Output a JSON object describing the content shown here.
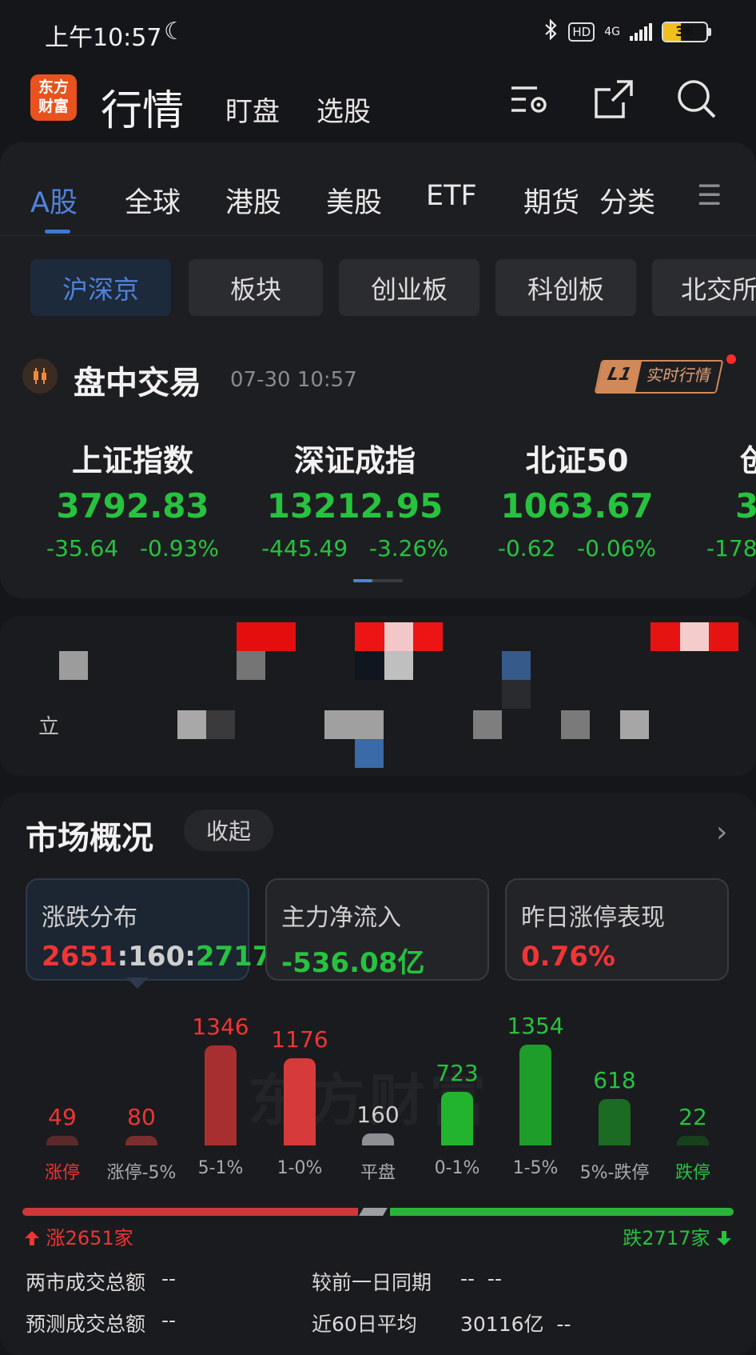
{
  "status_bar": {
    "time": "上午10:57",
    "hd": "HD",
    "network": "4G",
    "battery": "36"
  },
  "header": {
    "logo_text": "东方\n财富",
    "title": "行情",
    "tabs": [
      "盯盘",
      "选股"
    ]
  },
  "market_tabs": [
    "A股",
    "全球",
    "港股",
    "美股",
    "ETF",
    "期货",
    "分类"
  ],
  "chips": [
    "沪深京",
    "板块",
    "创业板",
    "科创板",
    "北交所"
  ],
  "session": {
    "title": "盘中交易",
    "time": "07-30 10:57",
    "badge_a": "L1",
    "badge_b": "实时行情"
  },
  "indices": [
    {
      "name": "上证指数",
      "value": "3792.83",
      "change": "-35.64",
      "pct": "-0.93%"
    },
    {
      "name": "深证成指",
      "value": "13212.95",
      "change": "-445.49",
      "pct": "-3.26%"
    },
    {
      "name": "北证50",
      "value": "1063.67",
      "change": "-0.62",
      "pct": "-0.06%"
    },
    {
      "name": "创",
      "value": "3",
      "change": "-178",
      "pct": ""
    }
  ],
  "mosaic": {
    "char": "立"
  },
  "overview": {
    "title": "市场概况",
    "collapse_label": "收起",
    "stats": [
      {
        "label": "涨跌分布",
        "up": "2651",
        "flat": "160",
        "down": "2717"
      },
      {
        "label": "主力净流入",
        "value": "-536.08亿"
      },
      {
        "label": "昨日涨停表现",
        "value": "0.76%"
      }
    ],
    "watermark": "东方财富",
    "distribution": [
      {
        "label": "涨停",
        "count": 49,
        "color": "#5a2a2a",
        "text_color": "#ef3535"
      },
      {
        "label": "涨停-5%",
        "count": 80,
        "color": "#7a2e2e",
        "text_color": "#ef3535"
      },
      {
        "label": "5-1%",
        "count": 1346,
        "color": "#a82f2f",
        "text_color": "#ef3535"
      },
      {
        "label": "1-0%",
        "count": 1176,
        "color": "#d63a3a",
        "text_color": "#ef3535"
      },
      {
        "label": "平盘",
        "count": 160,
        "color": "#8e8f94",
        "text_color": "#cfcfcf"
      },
      {
        "label": "0-1%",
        "count": 723,
        "color": "#22b42f",
        "text_color": "#27c23f"
      },
      {
        "label": "1-5%",
        "count": 1354,
        "color": "#1e9d2a",
        "text_color": "#27c23f"
      },
      {
        "label": "5%-跌停",
        "count": 618,
        "color": "#1b6b23",
        "text_color": "#27c23f"
      },
      {
        "label": "跌停",
        "count": 22,
        "color": "#17401b",
        "text_color": "#27c23f"
      }
    ],
    "up_text": "涨2651家",
    "down_text": "跌2717家",
    "rows": [
      {
        "label": "两市成交总额",
        "value": "--",
        "label2": "较前一日同期",
        "value2": "--  --"
      },
      {
        "label": "预测成交总额",
        "value": "--",
        "label2": "近60日平均",
        "value2": "30116亿  --"
      }
    ]
  }
}
